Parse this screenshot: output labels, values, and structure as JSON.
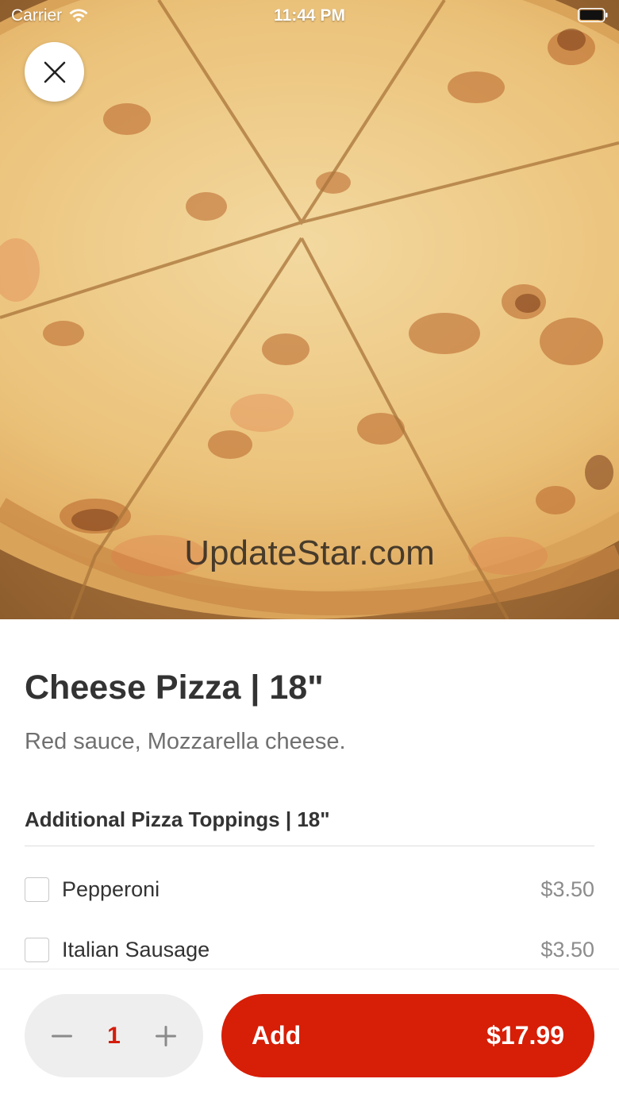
{
  "status_bar": {
    "carrier": "Carrier",
    "time": "11:44 PM"
  },
  "hero": {
    "image": "pizza-photo",
    "watermark": "UpdateStar.com"
  },
  "close_icon": "close-icon",
  "item": {
    "title": "Cheese Pizza | 18\"",
    "description": "Red sauce, Mozzarella cheese."
  },
  "toppings": {
    "title": "Additional Pizza Toppings | 18\"",
    "options": [
      {
        "name": "Pepperoni",
        "price": "$3.50",
        "checked": false
      },
      {
        "name": "Italian Sausage",
        "price": "$3.50",
        "checked": false
      }
    ]
  },
  "order": {
    "quantity": "1",
    "add_label": "Add",
    "total": "$17.99"
  },
  "colors": {
    "accent": "#d71e06",
    "quantity_text": "#d41d0d",
    "stepper_bg": "#eeeeee"
  }
}
